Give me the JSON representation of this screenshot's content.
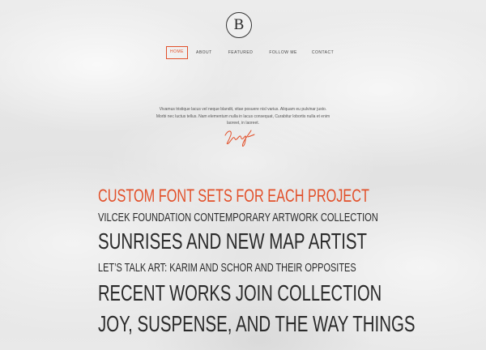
{
  "brand": {
    "logo_letter": "B",
    "accent_color": "#e2502a"
  },
  "nav": {
    "items": [
      {
        "label": "Home",
        "active": true
      },
      {
        "label": "About"
      },
      {
        "label": "Featured"
      },
      {
        "label": "Follow Me"
      },
      {
        "label": "Contact"
      }
    ]
  },
  "intro": {
    "text": "Vivamus tristique lacus vel neque blandit, vitae posuere nisl varius. Aliquam eu pulvinar justo. Morbi nec luctus tellus. Nam elementum nulla in lacus consequat, Curabitur lobortis nulla et enim laoreet, in laoreet.",
    "signature_icon": "handwritten-signature"
  },
  "headlines": [
    "CUSTOM FONT SETS FOR EACH PROJECT",
    "VILCEK FOUNDATION CONTEMPORARY ARTWORK COLLECTION",
    "SUNRISES AND NEW MAP ARTIST",
    "LET’S TALK ART: KARIM AND SCHOR AND THEIR OPPOSITES",
    "RECENT WORKS JOIN COLLECTION",
    "JOY, SUSPENSE, AND THE WAY THINGS"
  ]
}
